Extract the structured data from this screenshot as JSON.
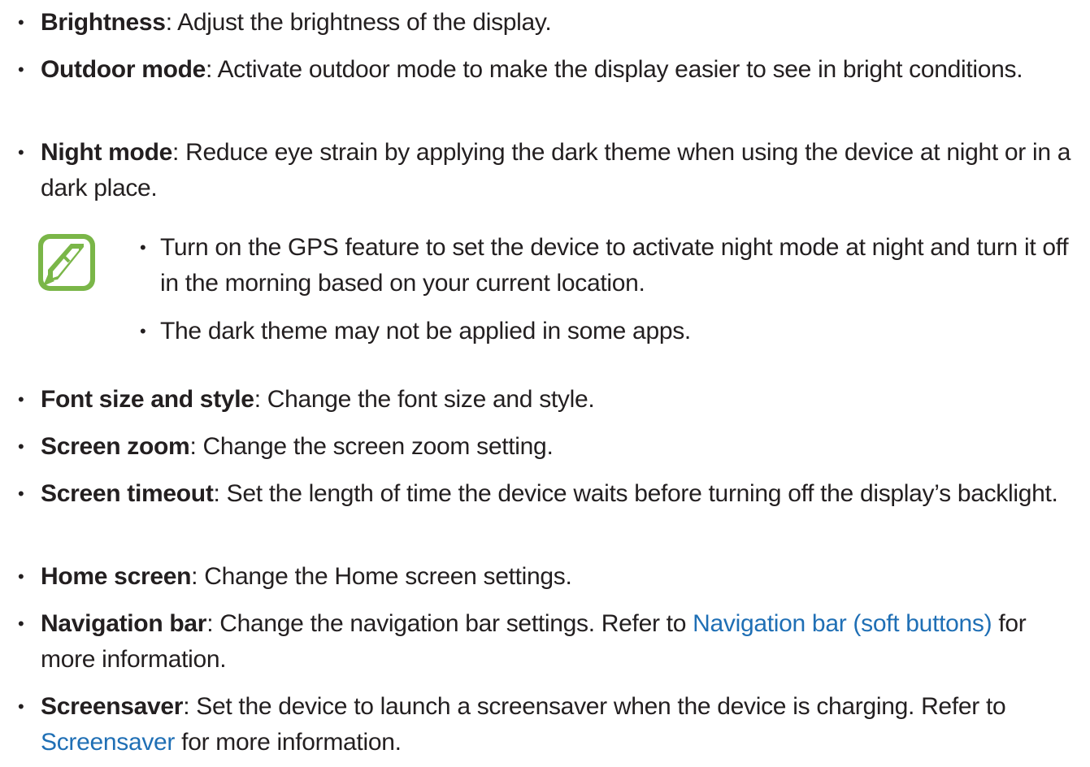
{
  "bullet_symbol": "•",
  "items": [
    {
      "term": "Brightness",
      "sep": ": ",
      "text": "Adjust the brightness of the display."
    },
    {
      "term": "Outdoor mode",
      "sep": ": ",
      "text": "Activate outdoor mode to make the display easier to see in bright conditions."
    },
    {
      "term": "Night mode",
      "sep": ": ",
      "text": "Reduce eye strain by applying the dark theme when using the device at night or in a dark place."
    },
    {
      "term": "Font size and style",
      "sep": ": ",
      "text": "Change the font size and style."
    },
    {
      "term": "Screen zoom",
      "sep": ": ",
      "text": "Change the screen zoom setting."
    },
    {
      "term": "Screen timeout",
      "sep": ": ",
      "text": "Set the length of time the device waits before turning off the display’s backlight."
    },
    {
      "term": "Home screen",
      "sep": ": ",
      "text": "Change the Home screen settings."
    },
    {
      "term": "Navigation bar",
      "sep": ": ",
      "text": "Change the navigation bar settings. Refer to ",
      "link": "Navigation bar (soft buttons)",
      "after": " for more information."
    },
    {
      "term": "Screensaver",
      "sep": ": ",
      "text": "Set the device to launch a screensaver when the device is charging. Refer to ",
      "link": "Screensaver",
      "after": " for more information."
    }
  ],
  "note": {
    "icon": "note-pencil-icon",
    "bullets": [
      "Turn on the GPS feature to set the device to activate night mode at night and turn it off in the morning based on your current location.",
      "The dark theme may not be applied in some apps."
    ]
  },
  "colors": {
    "text": "#231f20",
    "link": "#1f6fb5",
    "note_icon": "#7ab648"
  }
}
